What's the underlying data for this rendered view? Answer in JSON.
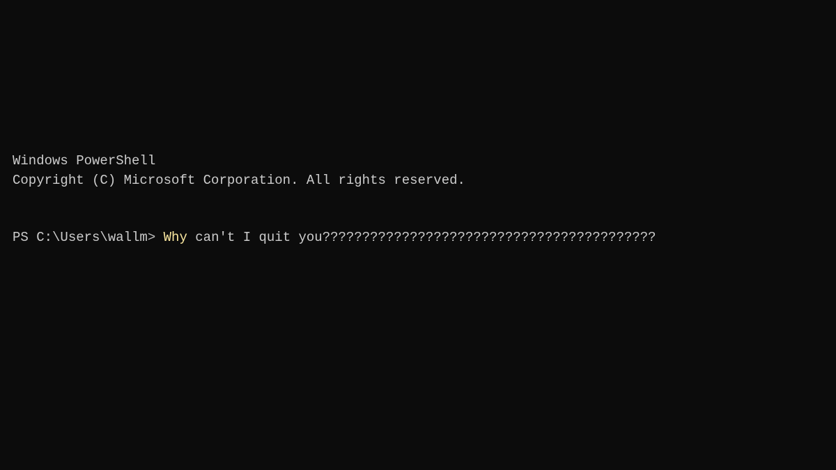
{
  "terminal": {
    "header": {
      "line1": "Windows PowerShell",
      "line2": "Copyright (C) Microsoft Corporation. All rights reserved."
    },
    "prompt": {
      "prefix": "PS C:\\Users\\wallm",
      "caret": "> ",
      "command_first_word": "Why",
      "command_rest": " can't I quit you??????????????????????????????????????????"
    }
  }
}
